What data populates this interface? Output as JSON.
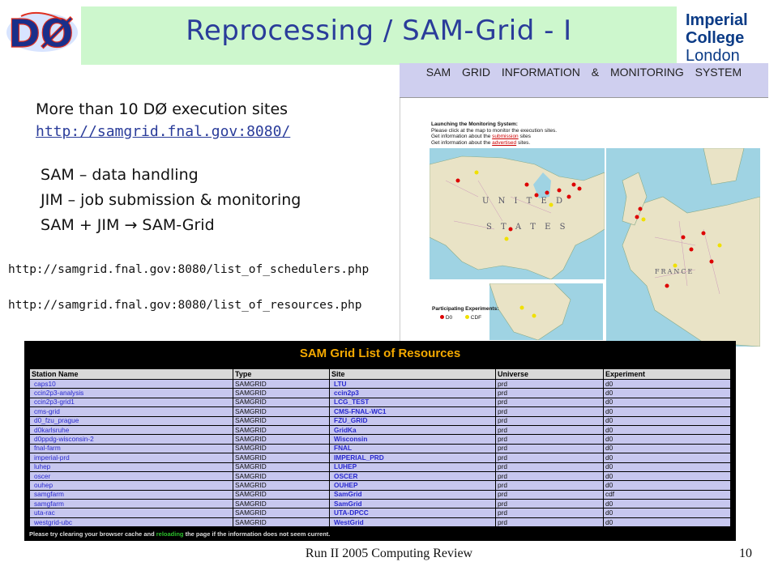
{
  "slide": {
    "title": "Reprocessing / SAM-Grid - I",
    "logo_left": "DØ",
    "logo_right_line1": "Imperial College",
    "logo_right_line2": "London",
    "bullets_top": [
      "More than 10 DØ execution sites"
    ],
    "link_main": "http://samgrid.fnal.gov:8080/",
    "bullets": [
      "SAM – data handling",
      "JIM – job submission & monitoring",
      "SAM + JIM → SAM-Grid"
    ],
    "url_schedulers": "http://samgrid.fnal.gov:8080/list_of_schedulers.php",
    "url_resources": "http://samgrid.fnal.gov:8080/list_of_resources.php",
    "footer_center": "Run II 2005 Computing Review",
    "page_number": "10"
  },
  "map_panel": {
    "header": "SAM GRID INFORMATION & MONITORING SYSTEM",
    "instructions_title": "Launching the Monitoring System:",
    "instructions_1": "Please click at the map to monitor the execution sites.",
    "instructions_2a": "Get information about the ",
    "instructions_2b": "submission",
    "instructions_2c": " sites",
    "instructions_3a": "Get information about the ",
    "instructions_3b": "advertised",
    "instructions_3c": " sites.",
    "legend_title": "Participating Experiments:",
    "legend_d0": "D0",
    "legend_cdf": "CDF",
    "colors": {
      "d0": "#dd0000",
      "cdf": "#f0e000",
      "water": "#9fd3e3",
      "land": "#e9e3c6"
    }
  },
  "resources": {
    "title": "SAM Grid List of Resources",
    "columns": [
      "Station Name",
      "Type",
      "Site",
      "Universe",
      "Experiment"
    ],
    "rows": [
      [
        "caps10",
        "SAMGRID",
        "LTU",
        "prd",
        "d0"
      ],
      [
        "ccin2p3-analysis",
        "SAMGRID",
        "ccin2p3",
        "prd",
        "d0"
      ],
      [
        "ccin2p3-grid1",
        "SAMGRID",
        "LCG_TEST",
        "prd",
        "d0"
      ],
      [
        "cms-grid",
        "SAMGRID",
        "CMS-FNAL-WC1",
        "prd",
        "d0"
      ],
      [
        "d0_fzu_prague",
        "SAMGRID",
        "FZU_GRID",
        "prd",
        "d0"
      ],
      [
        "d0karlsruhe",
        "SAMGRID",
        "GridKa",
        "prd",
        "d0"
      ],
      [
        "d0ppdg-wisconsin-2",
        "SAMGRID",
        "Wisconsin",
        "prd",
        "d0"
      ],
      [
        "fnal-farm",
        "SAMGRID",
        "FNAL",
        "prd",
        "d0"
      ],
      [
        "imperial-prd",
        "SAMGRID",
        "IMPERIAL_PRD",
        "prd",
        "d0"
      ],
      [
        "luhep",
        "SAMGRID",
        "LUHEP",
        "prd",
        "d0"
      ],
      [
        "oscer",
        "SAMGRID",
        "OSCER",
        "prd",
        "d0"
      ],
      [
        "ouhep",
        "SAMGRID",
        "OUHEP",
        "prd",
        "d0"
      ],
      [
        "samgfarm",
        "SAMGRID",
        "SamGrid",
        "prd",
        "cdf"
      ],
      [
        "samgfarm",
        "SAMGRID",
        "SamGrid",
        "prd",
        "d0"
      ],
      [
        "uta-rac",
        "SAMGRID",
        "UTA-DPCC",
        "prd",
        "d0"
      ],
      [
        "westgrid-ubc",
        "SAMGRID",
        "WestGrid",
        "prd",
        "d0"
      ]
    ],
    "footer_a": "Please try clearing your browser cache and ",
    "footer_b": "reloading",
    "footer_c": " the page if the information does not seem current."
  }
}
